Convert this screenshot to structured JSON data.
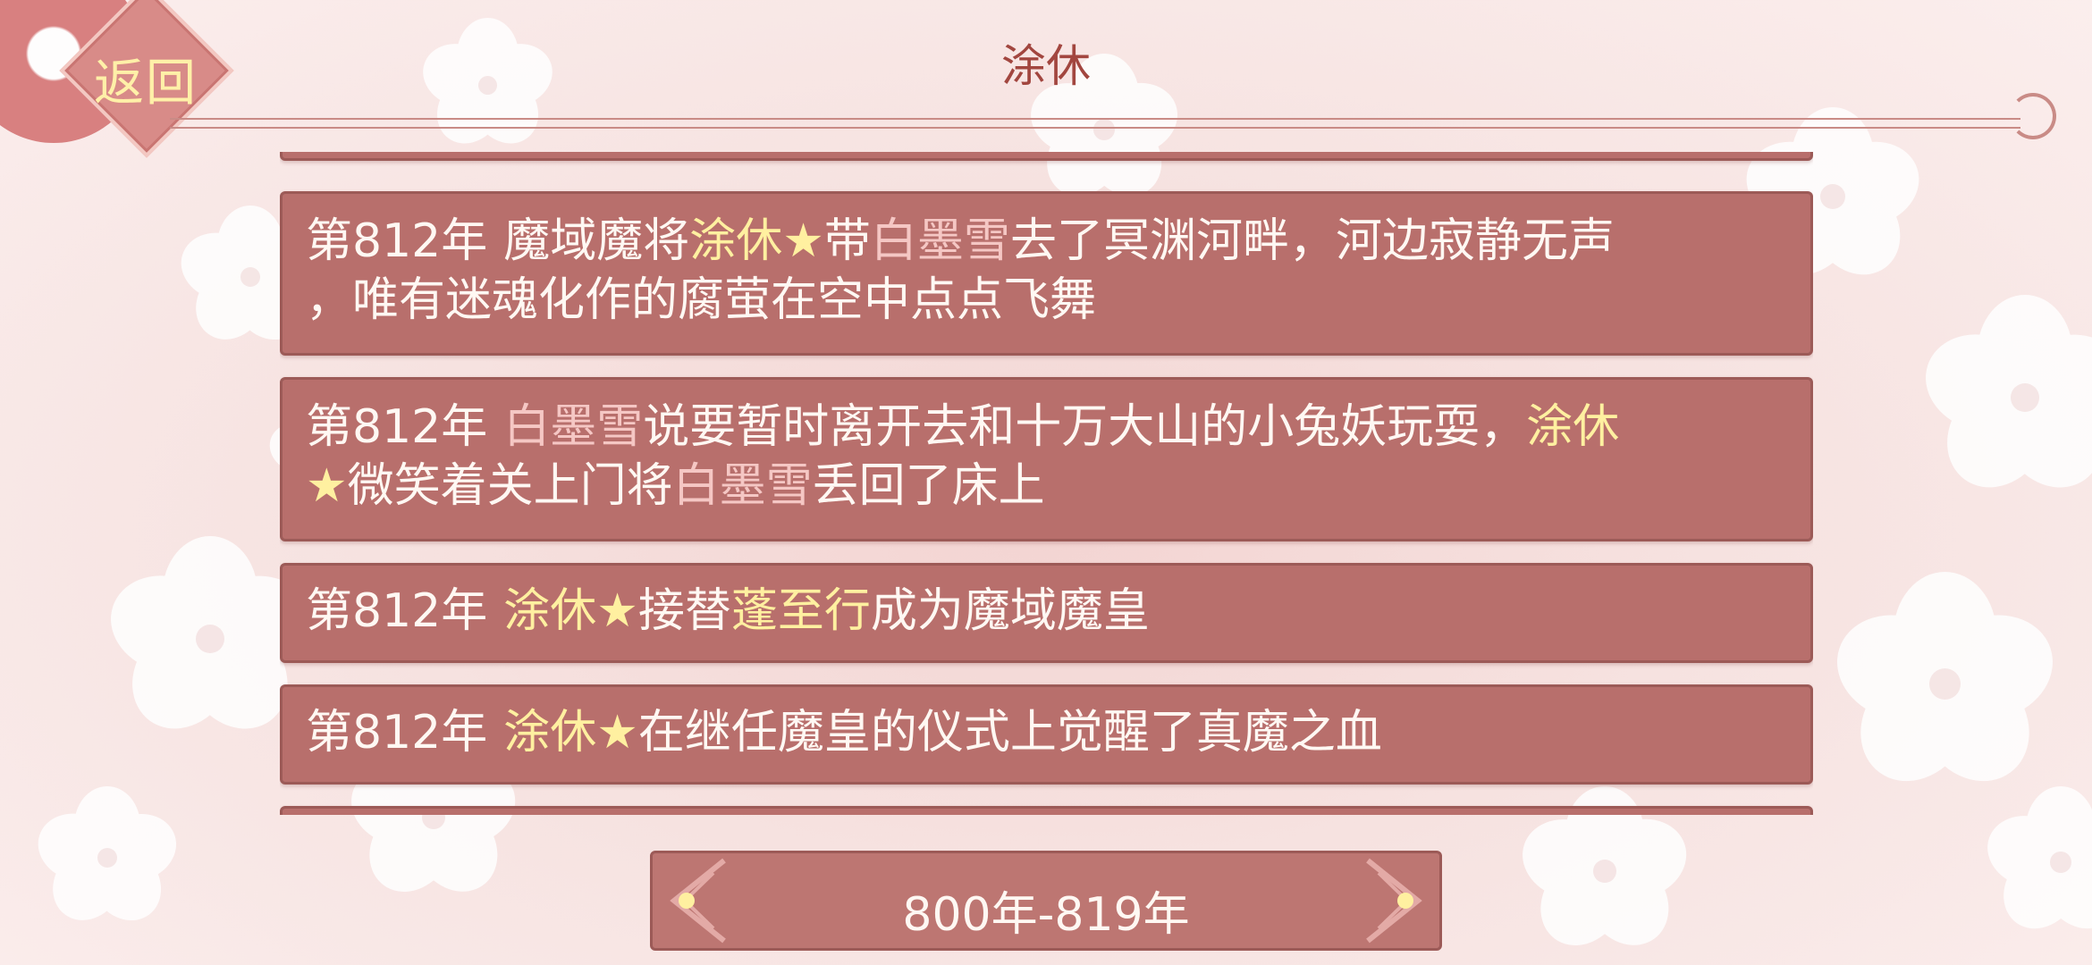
{
  "header": {
    "back_label": "返回",
    "title": "涂休"
  },
  "events": [
    {
      "year": "第812年",
      "segments": [
        {
          "t": "魔域魔将",
          "c": "w"
        },
        {
          "t": "涂休★",
          "c": "y"
        },
        {
          "t": "带",
          "c": "w"
        },
        {
          "t": "白墨雪",
          "c": "p"
        },
        {
          "t": "去了冥渊河畔，河边寂静无声",
          "c": "w"
        },
        {
          "br": true
        },
        {
          "t": "，唯有迷魂化作的腐萤在空中点点飞舞",
          "c": "w"
        }
      ]
    },
    {
      "year": "第812年",
      "segments": [
        {
          "t": "白墨雪",
          "c": "p"
        },
        {
          "t": "说要暂时离开去和十万大山的小兔妖玩耍，",
          "c": "w"
        },
        {
          "t": "涂休",
          "c": "y"
        },
        {
          "br": true
        },
        {
          "t": "★",
          "c": "y"
        },
        {
          "t": "微笑着关上门将",
          "c": "w"
        },
        {
          "t": "白墨雪",
          "c": "p"
        },
        {
          "t": "丢回了床上",
          "c": "w"
        }
      ]
    },
    {
      "year": "第812年",
      "segments": [
        {
          "t": "涂休★",
          "c": "y"
        },
        {
          "t": "接替",
          "c": "w"
        },
        {
          "t": "蓬至行",
          "c": "y"
        },
        {
          "t": "成为魔域魔皇",
          "c": "w"
        }
      ]
    },
    {
      "year": "第812年",
      "segments": [
        {
          "t": "涂休★",
          "c": "y"
        },
        {
          "t": "在继任魔皇的仪式上觉醒了真魔之血",
          "c": "w"
        }
      ]
    }
  ],
  "pager": {
    "label": "800年-819年"
  },
  "icons": {
    "back": "back-diamond-icon",
    "prev": "chevron-left-icon",
    "next": "chevron-right-icon"
  },
  "colors": {
    "card": "#b86f6c",
    "highlight_name": "#fff0a0",
    "highlight_other": "#f5c7c4",
    "title": "#a2463f"
  }
}
